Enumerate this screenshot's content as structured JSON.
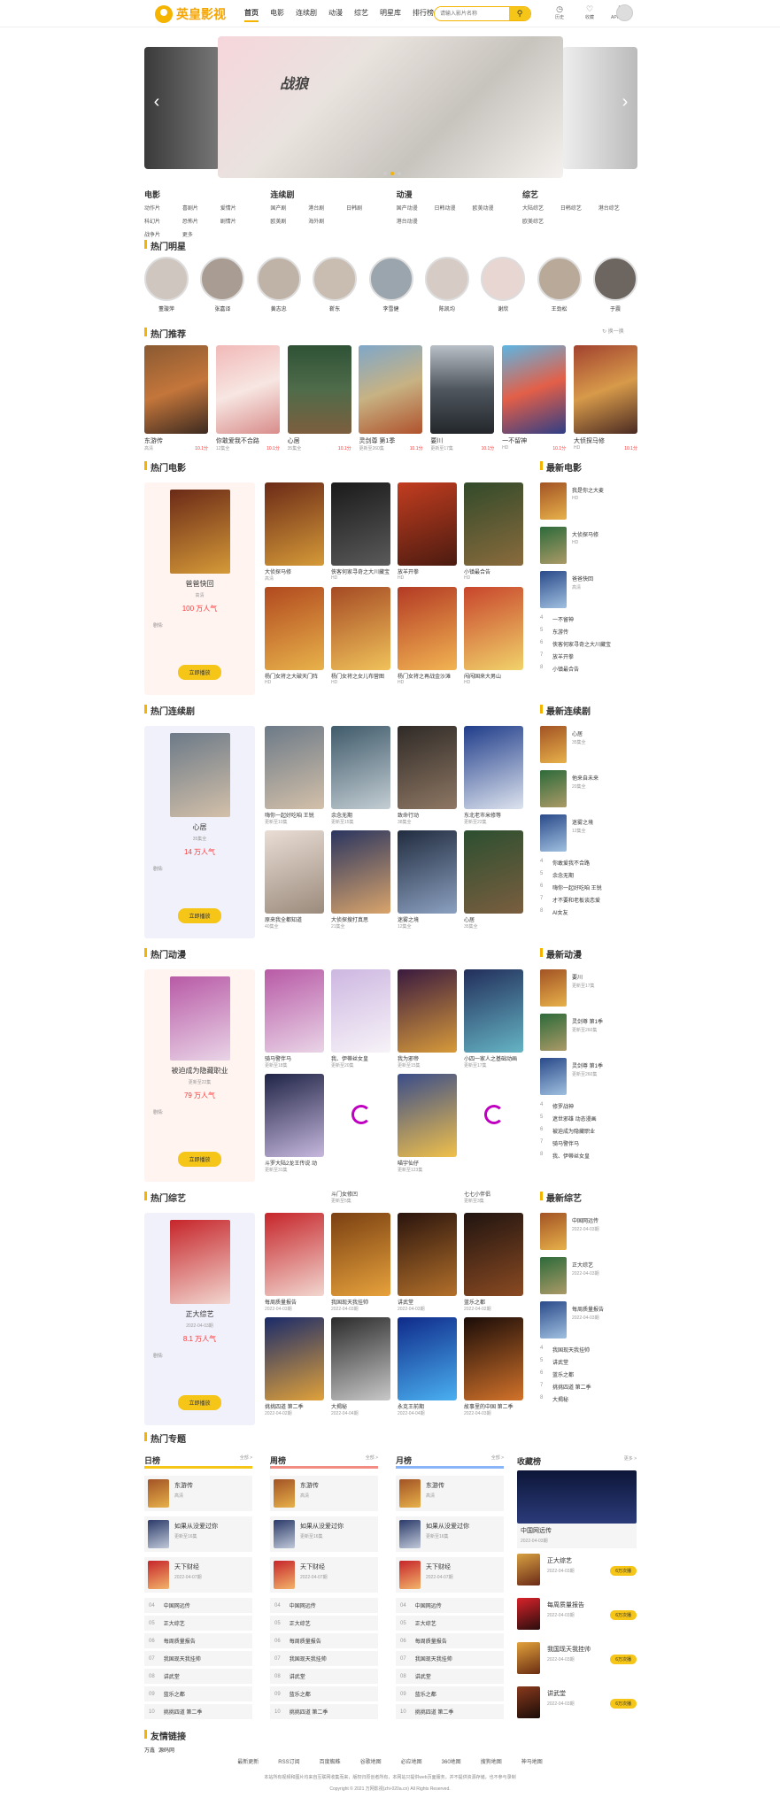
{
  "header": {
    "logo": "英皇影视",
    "nav": [
      "首页",
      "电影",
      "连续剧",
      "动漫",
      "综艺",
      "明星库",
      "排行榜"
    ],
    "search_placeholder": "请输入影片名称",
    "icons": [
      {
        "name": "history",
        "label": "历史"
      },
      {
        "name": "favorite",
        "label": "收藏"
      },
      {
        "name": "app",
        "label": "APP下载"
      }
    ]
  },
  "banner": {
    "title": "战狼"
  },
  "categories": [
    {
      "title": "电影",
      "links": [
        "动作片",
        "喜剧片",
        "爱情片",
        "科幻片",
        "恐怖片",
        "剧情片",
        "战争片",
        "更多"
      ]
    },
    {
      "title": "连续剧",
      "links": [
        "国产剧",
        "港台剧",
        "日韩剧",
        "欧美剧",
        "海外剧"
      ]
    },
    {
      "title": "动漫",
      "links": [
        "国产动漫",
        "日韩动漫",
        "欧美动漫",
        "港台动漫"
      ]
    },
    {
      "title": "综艺",
      "links": [
        "大陆综艺",
        "日韩综艺",
        "港台综艺",
        "欧美综艺"
      ]
    }
  ],
  "hot_stars": {
    "title": "热门明星",
    "names": [
      "董璇萍",
      "张嘉译",
      "黄志忠",
      "靳东",
      "李雪健",
      "陈凯均",
      "谢欣",
      "王劲松",
      "于震"
    ]
  },
  "hot_recommend": {
    "title": "热门推荐",
    "refresh": "换一换",
    "items": [
      {
        "name": "东游传",
        "sub": "高清",
        "score": "10.1分"
      },
      {
        "name": "你敢爱我不合路",
        "sub": "12集全",
        "score": "10.1分"
      },
      {
        "name": "心居",
        "sub": "35集全",
        "score": "10.1分"
      },
      {
        "name": "灵剑尊 第1季",
        "sub": "更新至260集",
        "score": "10.1分"
      },
      {
        "name": "要川",
        "sub": "更新至17集",
        "score": "10.1分"
      },
      {
        "name": "一不留神",
        "sub": "HD",
        "score": "10.1分"
      },
      {
        "name": "大侦探马修",
        "sub": "HD",
        "score": "10.1分"
      }
    ]
  },
  "sections": [
    {
      "title": "热门电影",
      "side_title": "最新电影",
      "featured": {
        "name": "爸爸快回",
        "sub": "高清",
        "heat": "100 万人气",
        "desc": "剧情:",
        "btn": "立即播放"
      },
      "grid": [
        {
          "n": "大侦探马修",
          "s": "高清"
        },
        {
          "n": "侠客何家寻奇之大川藏宝",
          "s": "HD"
        },
        {
          "n": "放羊开拳",
          "s": "HD"
        },
        {
          "n": "小镇最合告",
          "s": "HD"
        },
        {
          "n": "杨门女将之大破天门阵",
          "s": "HD"
        },
        {
          "n": "杨门女将之女儿布营图",
          "s": "HD"
        },
        {
          "n": "杨门女将之再战金沙滩",
          "s": "HD"
        },
        {
          "n": "闯闯国来大男山",
          "s": "HD"
        }
      ],
      "rank": {
        "top": [
          {
            "n": "我是你之大麦",
            "s": "HD"
          },
          {
            "n": "大侦探马修",
            "s": "HD"
          },
          {
            "n": "爸爸快回",
            "s": "高清"
          }
        ],
        "list": [
          "一不留神",
          "东游传",
          "侠客何家寻奇之大川藏宝",
          "放羊开拳",
          "小镇最合告"
        ]
      }
    },
    {
      "title": "热门连续剧",
      "side_title": "最新连续剧",
      "featured": {
        "name": "心居",
        "sub": "35集全",
        "heat": "14 万人气",
        "desc": "剧情:",
        "btn": "立即播放"
      },
      "grid": [
        {
          "n": "嗨你一起好吃咱 王锐",
          "s": "更新至10集"
        },
        {
          "n": "余念无期",
          "s": "更新至15集"
        },
        {
          "n": "致命行动",
          "s": "38集全"
        },
        {
          "n": "东北老市米修等",
          "s": "更新至22集"
        },
        {
          "n": "原来我全都知道",
          "s": "40集全"
        },
        {
          "n": "大侦探搜打真思",
          "s": "21集全"
        },
        {
          "n": "迷雾之境",
          "s": "12集全"
        },
        {
          "n": "心居",
          "s": "35集全"
        }
      ],
      "rank": {
        "top": [
          {
            "n": "心居",
            "s": "35集全"
          },
          {
            "n": "他来自未来",
            "s": "20集全"
          },
          {
            "n": "迷雾之境",
            "s": "12集全"
          }
        ],
        "list": [
          "你敢爱我不合路",
          "余念无期",
          "嗨你一起好吃咱 王锐",
          "才不要和老板谈恋爱",
          "AI女友"
        ]
      }
    },
    {
      "title": "热门动漫",
      "side_title": "最新动漫",
      "featured": {
        "name": "被迫成为隐藏职业",
        "sub": "更新至22集",
        "heat": "79 万人气",
        "desc": "剧情:",
        "btn": "立即播放"
      },
      "grid": [
        {
          "n": "骑马警伴马",
          "s": "更新至18集"
        },
        {
          "n": "我、伊蒂丝女皇",
          "s": "更新至20集"
        },
        {
          "n": "我为邪帝",
          "s": "更新至15集"
        },
        {
          "n": "小四一家人之基础动画",
          "s": "更新至17集"
        },
        {
          "n": "斗罗大陆2龙王传说 动",
          "s": "更新至31集"
        },
        {
          "n": "斗门女修凹",
          "s": "更新至5集"
        },
        {
          "n": "喵宇仙仔",
          "s": "更新至123集"
        },
        {
          "n": "七七小伴侣",
          "s": "更新至3集"
        }
      ],
      "rank": {
        "top": [
          {
            "n": "要川",
            "s": "更新至17集"
          },
          {
            "n": "灵剑尊 第1季",
            "s": "更新至260集"
          },
          {
            "n": "灵剑尊 第1季",
            "s": "更新至260集"
          }
        ],
        "list": [
          "修罗战神",
          "遮世邪雄 动态漫画",
          "被迫成为隐藏职业",
          "骑马警伴马",
          "我、伊蒂丝女皇"
        ]
      }
    },
    {
      "title": "热门综艺",
      "side_title": "最新综艺",
      "featured": {
        "name": "正大综艺",
        "sub": "2022-04-03期",
        "heat": "8.1 万人气",
        "desc": "剧情:",
        "btn": "立即播放"
      },
      "grid": [
        {
          "n": "每周质量报告",
          "s": "2022-04-03期"
        },
        {
          "n": "我国现天我挂帅",
          "s": "2022-04-03期"
        },
        {
          "n": "讲武堂",
          "s": "2022-04-03期"
        },
        {
          "n": "蓝乐之都",
          "s": "2022-04-02期"
        },
        {
          "n": "挑挑四道 第二季",
          "s": "2022-04-02期"
        },
        {
          "n": "大揭秘",
          "s": "2022-04-04期"
        },
        {
          "n": "永克王前期",
          "s": "2022-04-04期"
        },
        {
          "n": "故事里的中国 第二季",
          "s": "2022-04-03期"
        }
      ],
      "rank": {
        "top": [
          {
            "n": "中国网远传",
            "s": "2022-04-03期"
          },
          {
            "n": "正大综艺",
            "s": "2022-04-03期"
          },
          {
            "n": "每周质量报告",
            "s": "2022-04-03期"
          }
        ],
        "list": [
          "我国现天我挂帅",
          "讲武堂",
          "蓝乐之都",
          "挑挑四道 第二季",
          "大揭秘"
        ]
      }
    }
  ],
  "topics": {
    "title": "热门专题"
  },
  "boards": [
    {
      "title": "日榜",
      "more": "全部 >"
    },
    {
      "title": "周榜",
      "more": "全部 >"
    },
    {
      "title": "月榜",
      "more": "全部 >"
    }
  ],
  "board_items": {
    "top": [
      {
        "n": "东游传",
        "s": "高清"
      },
      {
        "n": "如果从没爱过你",
        "s": "更新至16集"
      },
      {
        "n": "天下财经",
        "s": "2022-04-07期"
      }
    ],
    "list": [
      {
        "no": "04",
        "n": "中国网远传"
      },
      {
        "no": "05",
        "n": "正大综艺"
      },
      {
        "no": "06",
        "n": "每周质量报告"
      },
      {
        "no": "07",
        "n": "我国现天我挂帅"
      },
      {
        "no": "08",
        "n": "讲武堂"
      },
      {
        "no": "09",
        "n": "蓝乐之都"
      },
      {
        "no": "10",
        "n": "挑挑四道 第二季"
      }
    ]
  },
  "favorites": {
    "title": "收藏榜",
    "more": "更多 >",
    "big": {
      "n": "中国网远传",
      "s": "2022-04-03期"
    },
    "items": [
      {
        "n": "正大综艺",
        "s": "2022-04-03期",
        "btn": "6万次播"
      },
      {
        "n": "每周质量报告",
        "s": "2022-04-03期",
        "btn": "6万次播"
      },
      {
        "n": "我国现天我挂帅",
        "s": "2022-04-03期",
        "btn": "6万次播"
      },
      {
        "n": "讲武堂",
        "s": "2022-04-03期",
        "btn": "6万次播"
      }
    ]
  },
  "links": {
    "title": "友情链接",
    "items": [
      "万鑫",
      "源码网"
    ]
  },
  "footer": {
    "links": [
      "最新更新",
      "RSS订阅",
      "百度蜘蛛",
      "谷歌地图",
      "必应地图",
      "360地图",
      "搜狗地图",
      "神马地图"
    ],
    "disclaimer": "本站所有视频和图片均来自互联网收集而来，版权归原创者所有，本网站只提供web页面服务，并不提供资源存储，也不参与录制",
    "copyright": "Copyright © 2021 万网影视(zhi-020a.cn) All Rights Reserved."
  },
  "colors": {
    "accent": "#f5b400",
    "price": "#ff3333"
  }
}
